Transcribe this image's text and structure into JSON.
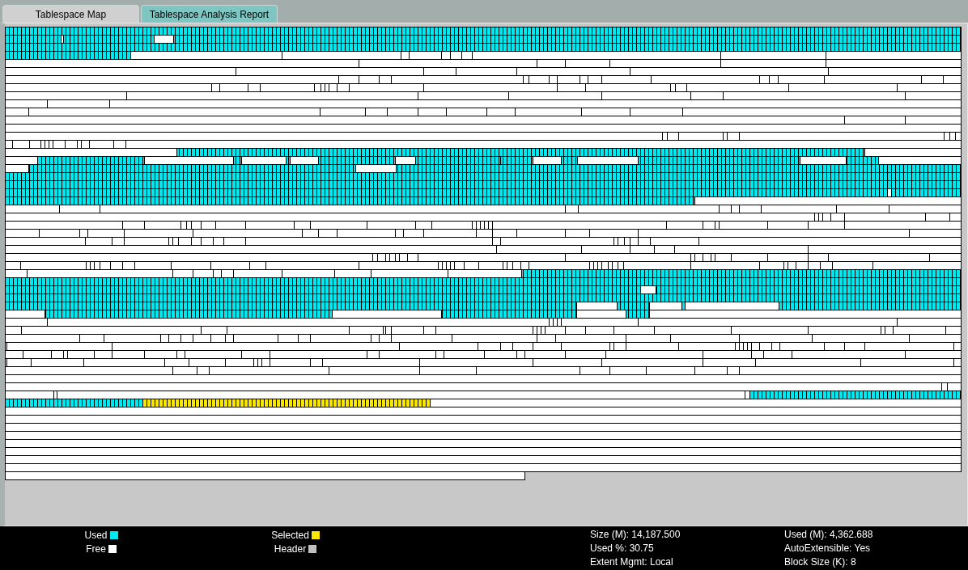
{
  "tabs": [
    {
      "label": "Tablespace Map",
      "selected": true
    },
    {
      "label": "Tablespace Analysis Report",
      "selected": false
    }
  ],
  "legend": [
    {
      "kind": "used",
      "label": "Used",
      "color": "#00e8f0"
    },
    {
      "kind": "free",
      "label": "Free",
      "color": "#ffffff"
    },
    {
      "kind": "selected",
      "label": "Selected",
      "color": "#f8e800"
    },
    {
      "kind": "header",
      "label": "Header",
      "color": "#c0c0c0"
    }
  ],
  "stats": [
    {
      "label": "Size (M): 14,187.500"
    },
    {
      "label": "Used %: 30.75"
    },
    {
      "label": "Extent Mgmt: Local"
    },
    {
      "label": "Used (M): 4,362.688"
    },
    {
      "label": "AutoExtensible: Yes"
    },
    {
      "label": "Block Size (K): 8"
    }
  ]
}
